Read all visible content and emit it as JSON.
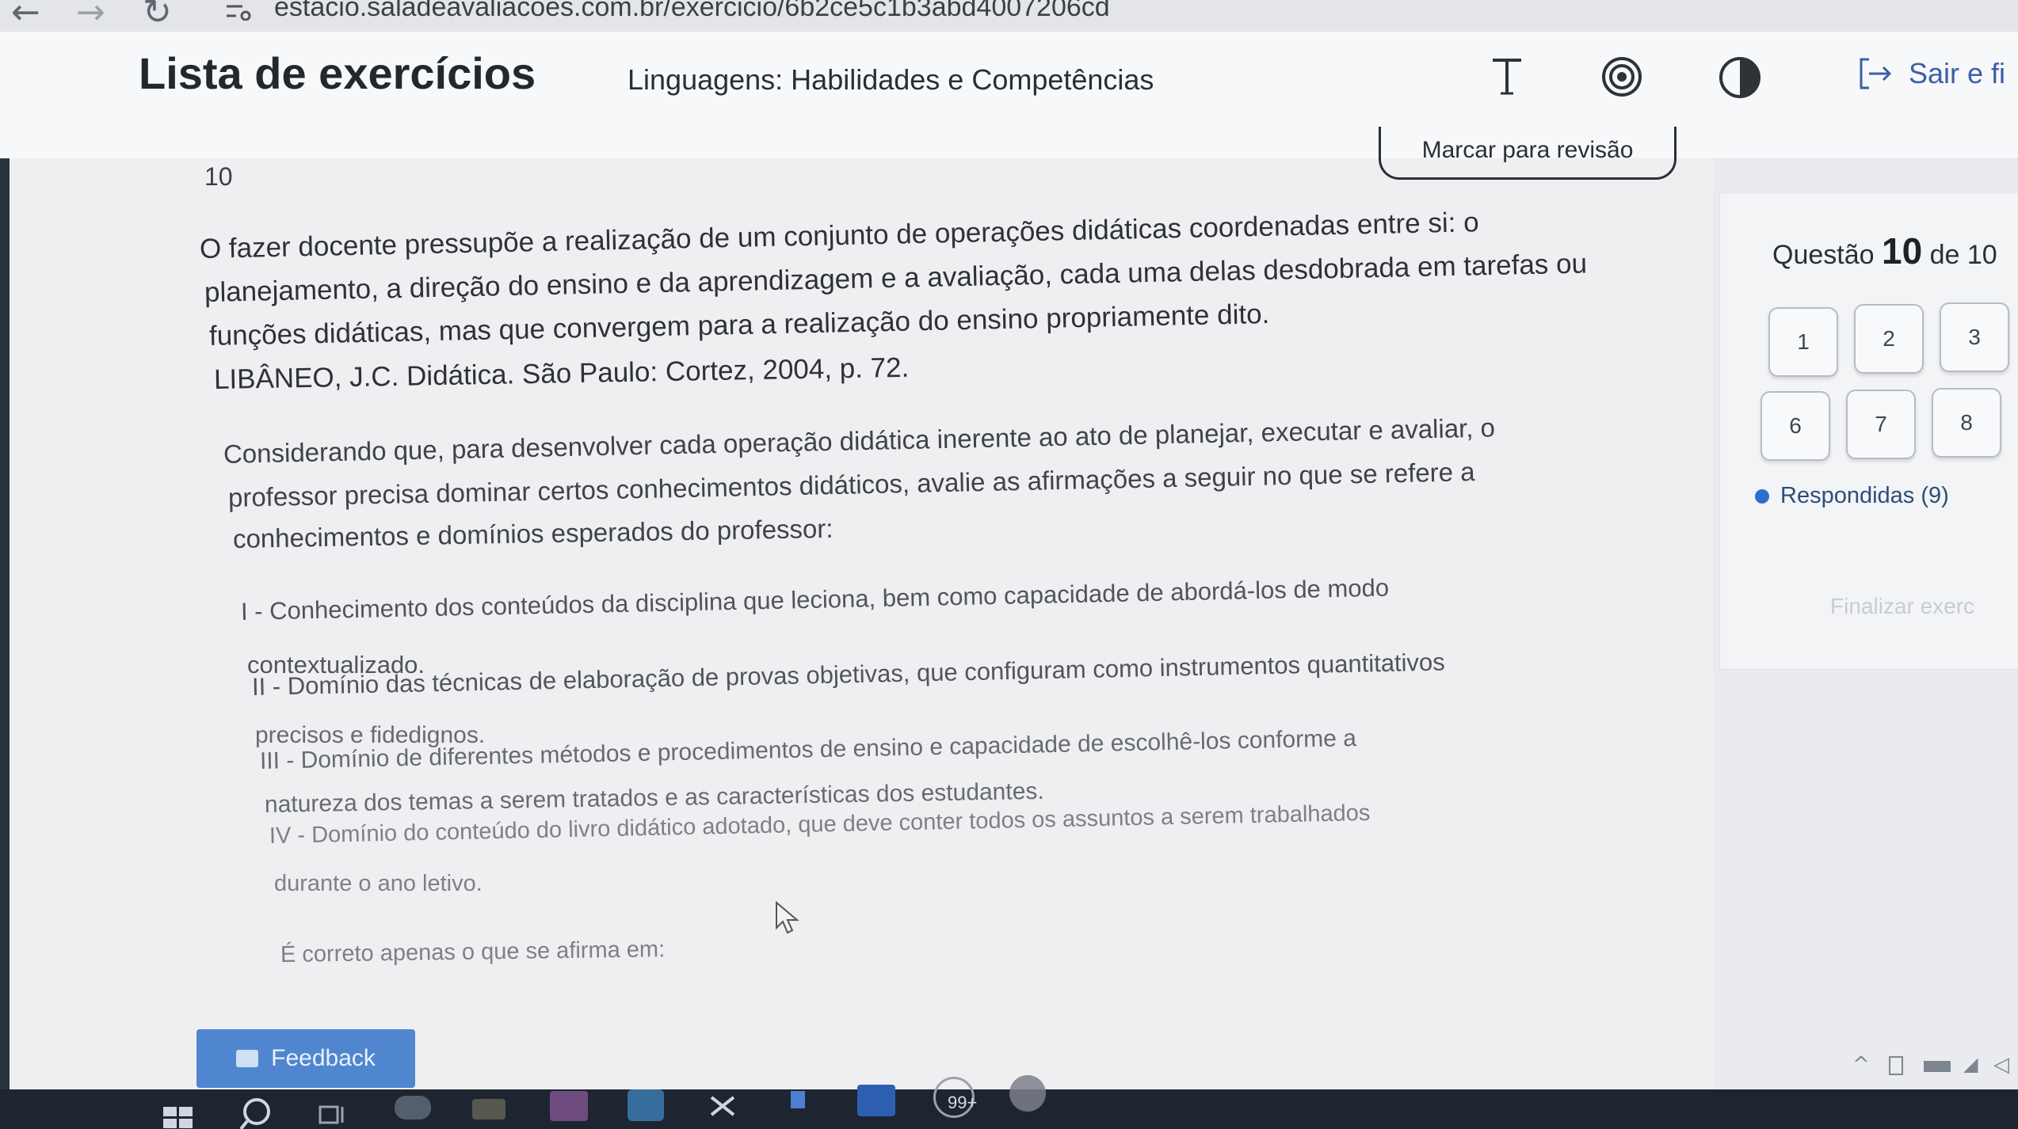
{
  "browser": {
    "back_icon": "arrow-left-icon",
    "forward_icon": "arrow-right-icon",
    "reload_icon": "reload-icon",
    "url": "estacio.saladeavaliacoes.com.br/exercicio/6b2ce5c1b3abd4007206cd"
  },
  "header": {
    "title": "Lista de exercícios",
    "subtitle": "Linguagens: Habilidades e Competências",
    "tools": [
      "text-size-icon",
      "target-icon",
      "contrast-icon"
    ],
    "exit_label": "Sair e fi"
  },
  "question": {
    "number": "10",
    "review_label": "Marcar para revisão",
    "lines": [
      "O fazer docente pressupõe a realização de um conjunto de operações didáticas coordenadas entre si: o",
      "planejamento, a direção do ensino e da aprendizagem e a avaliação, cada uma delas desdobrada em tarefas ou",
      "funções didáticas, mas que convergem para a realização do ensino propriamente dito.",
      "LIBÂNEO, J.C. Didática. São Paulo: Cortez, 2004, p. 72.",
      "Considerando que, para desenvolver cada operação didática inerente ao ato de planejar, executar e avaliar, o",
      "professor precisa dominar certos conhecimentos didáticos, avalie as afirmações a seguir no que se refere a",
      "conhecimentos e domínios esperados do professor:",
      "I - Conhecimento dos conteúdos da disciplina que leciona, bem como capacidade de abordá-los de modo",
      "contextualizado.",
      "II - Domínio das técnicas de elaboração de provas objetivas, que configuram como instrumentos quantitativos",
      "precisos e fidedignos.",
      "III - Domínio de diferentes métodos e procedimentos de ensino e capacidade de escolhê-los conforme a",
      "natureza dos temas a serem tratados e as características dos estudantes.",
      "IV - Domínio do conteúdo do livro didático adotado, que deve conter todos os assuntos a serem trabalhados",
      "durante o ano letivo.",
      "É correto apenas o que se afirma em:"
    ]
  },
  "side": {
    "counter_prefix": "Questão",
    "counter_current": "10",
    "counter_suffix": "de 10",
    "buttons": [
      "1",
      "2",
      "3",
      "6",
      "7",
      "8"
    ],
    "answered_label": "Respondidas (9)",
    "finish_label": "Finalizar exerc"
  },
  "feedback": {
    "label": "Feedback"
  },
  "taskbar": {
    "badge": "99+"
  }
}
